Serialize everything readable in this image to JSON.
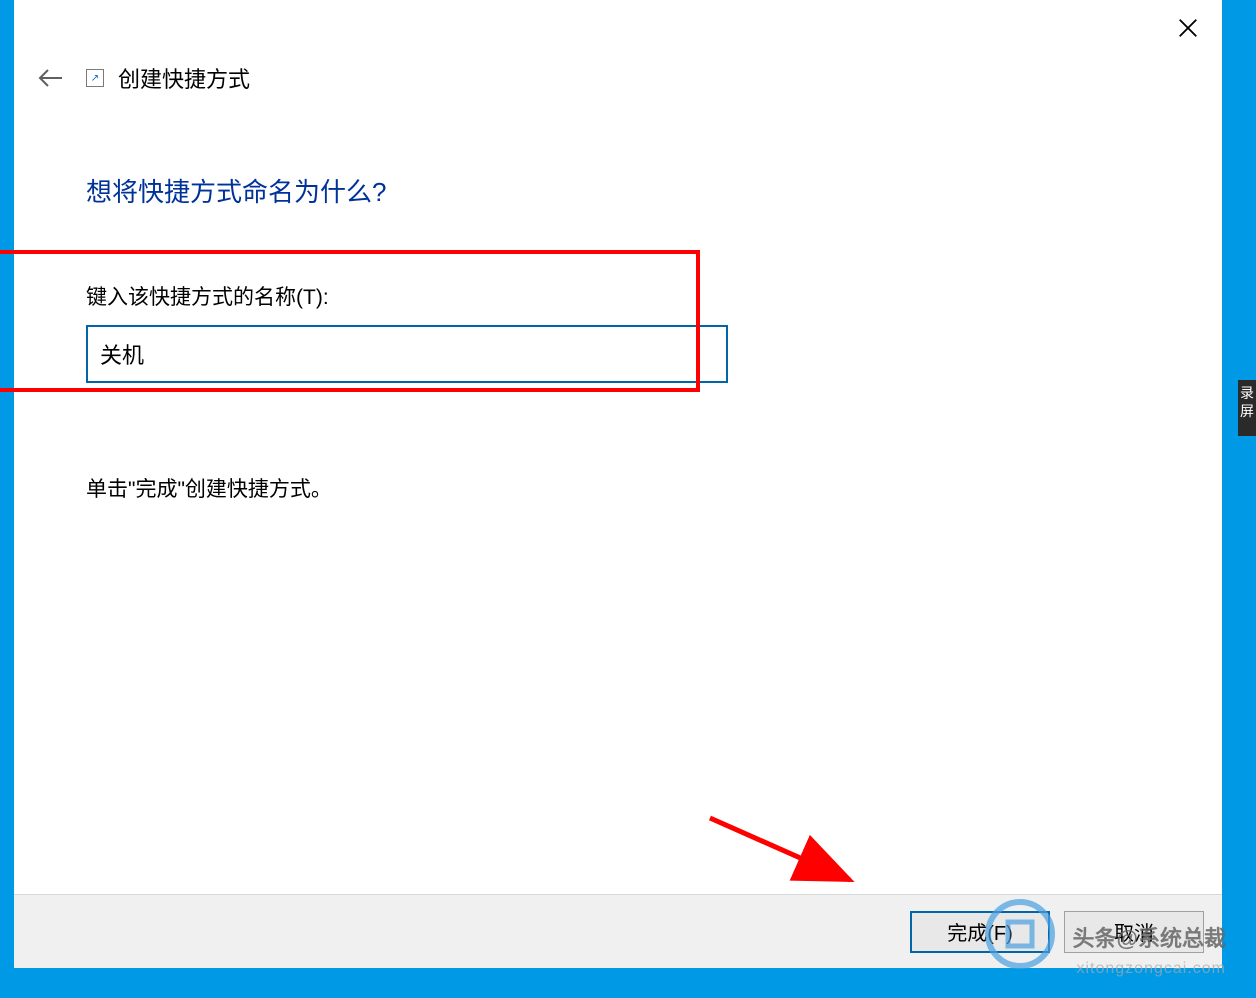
{
  "titlebar": {
    "close_label": "Close"
  },
  "header": {
    "back_label": "Back",
    "title": "创建快捷方式"
  },
  "content": {
    "heading": "想将快捷方式命名为什么?",
    "input_label": "键入该快捷方式的名称(T):",
    "input_value": "关机",
    "instruction": "单击\"完成\"创建快捷方式。"
  },
  "footer": {
    "finish_label": "完成(F)",
    "cancel_label": "取消"
  },
  "watermark": {
    "text": "头条@系统总裁",
    "sub": "xitongzongcai.com"
  },
  "side": {
    "text": "录屏"
  }
}
